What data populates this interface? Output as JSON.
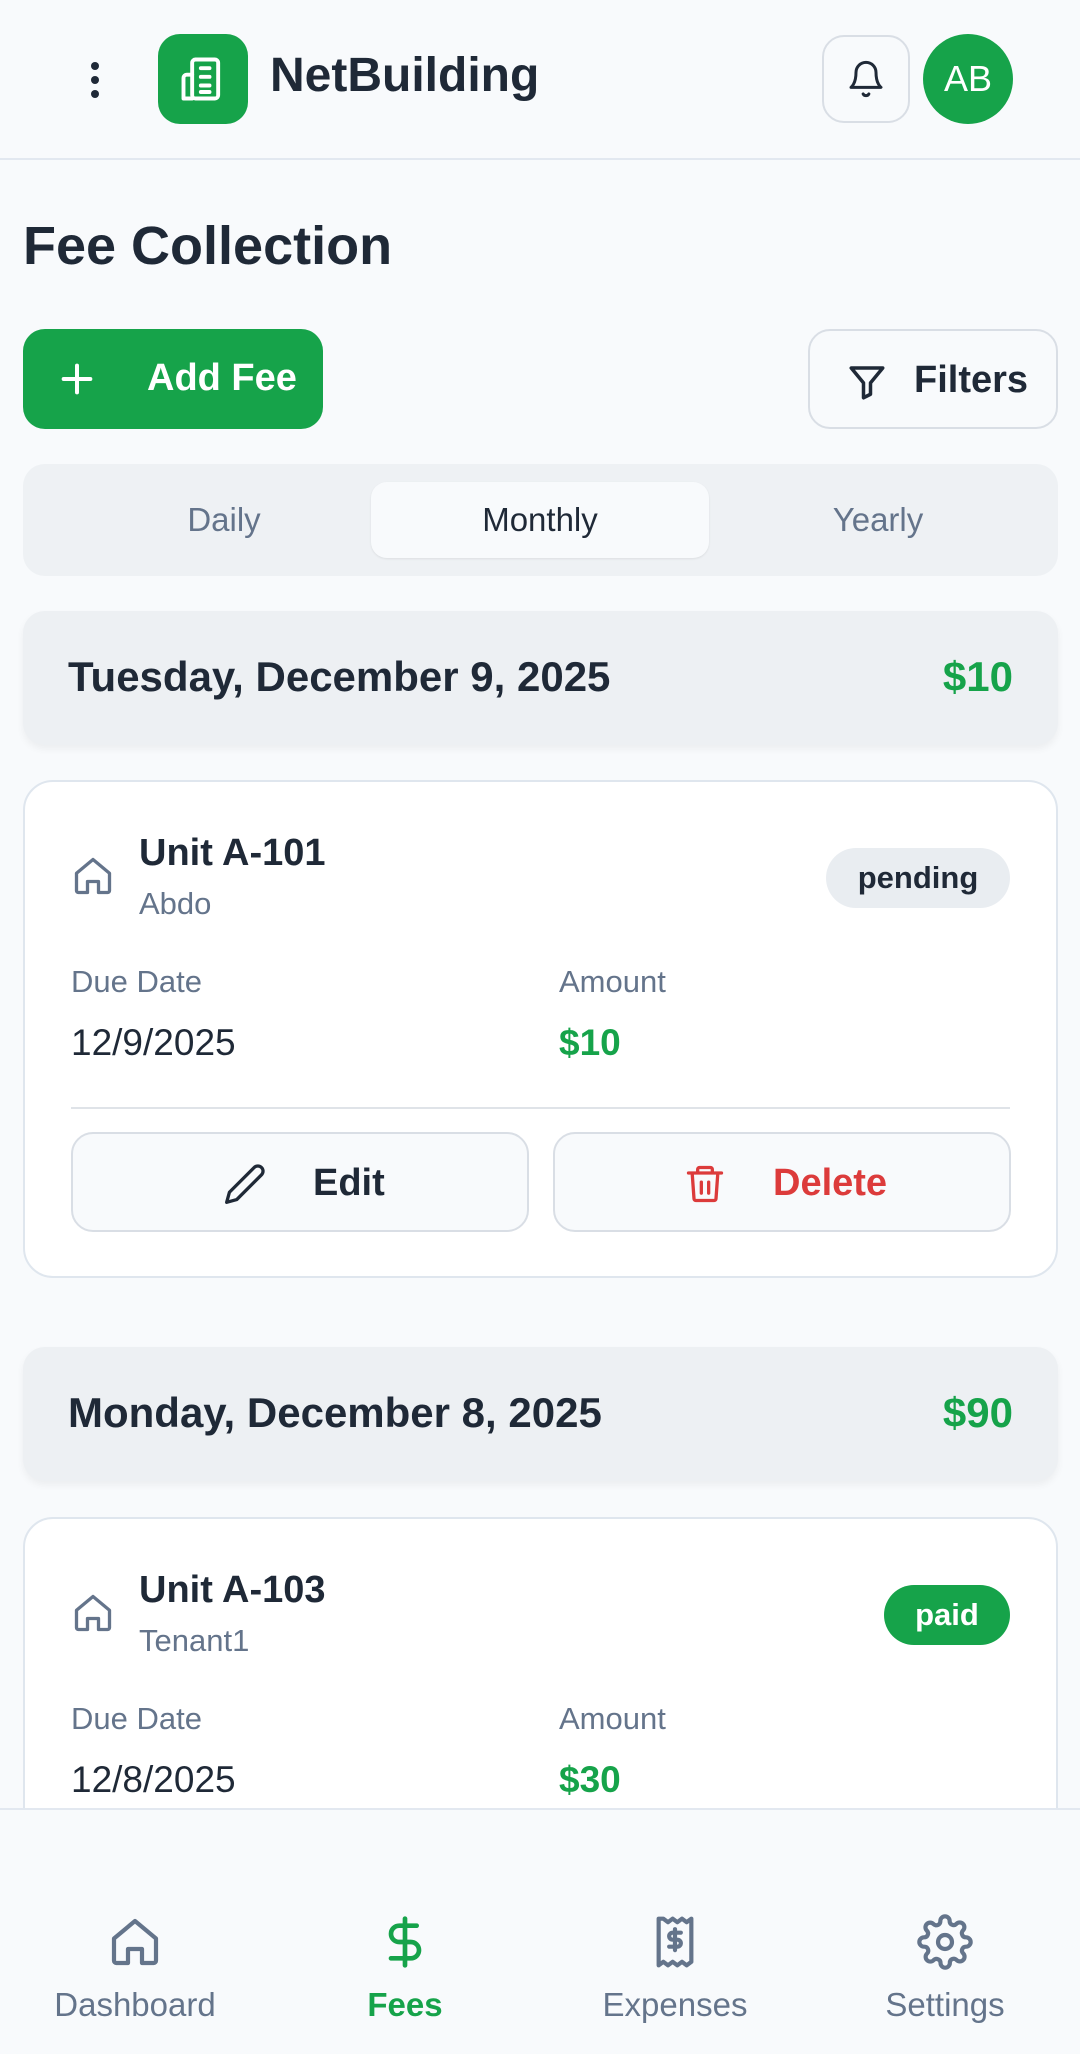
{
  "header": {
    "app_title": "NetBuilding",
    "avatar_initials": "AB",
    "icons": [
      "more-vertical-icon",
      "building-icon",
      "bell-icon"
    ]
  },
  "page": {
    "title": "Fee Collection",
    "add_button_label": "Add Fee",
    "filters_label": "Filters"
  },
  "tabs": [
    {
      "label": "Daily",
      "active": false
    },
    {
      "label": "Monthly",
      "active": true
    },
    {
      "label": "Yearly",
      "active": false
    }
  ],
  "groups": [
    {
      "date": "Tuesday, December 9, 2025",
      "total": "$10",
      "fees": [
        {
          "unit": "Unit A-101",
          "tenant": "Abdo",
          "status": "pending",
          "due_date_label": "Due Date",
          "due_date": "12/9/2025",
          "amount_label": "Amount",
          "amount": "$10",
          "edit_label": "Edit",
          "delete_label": "Delete"
        }
      ]
    },
    {
      "date": "Monday, December 8, 2025",
      "total": "$90",
      "fees": [
        {
          "unit": "Unit A-103",
          "tenant": "Tenant1",
          "status": "paid",
          "due_date_label": "Due Date",
          "due_date": "12/8/2025",
          "amount_label": "Amount",
          "amount": "$30"
        }
      ]
    }
  ],
  "bottom_nav": [
    {
      "label": "Dashboard",
      "icon": "home-icon",
      "active": false
    },
    {
      "label": "Fees",
      "icon": "dollar-icon",
      "active": true
    },
    {
      "label": "Expenses",
      "icon": "receipt-icon",
      "active": false
    },
    {
      "label": "Settings",
      "icon": "gear-icon",
      "active": false
    }
  ],
  "colors": {
    "brand": "#16a34a",
    "danger": "#dc3b3b",
    "muted": "#64748b",
    "text": "#1f2937"
  }
}
